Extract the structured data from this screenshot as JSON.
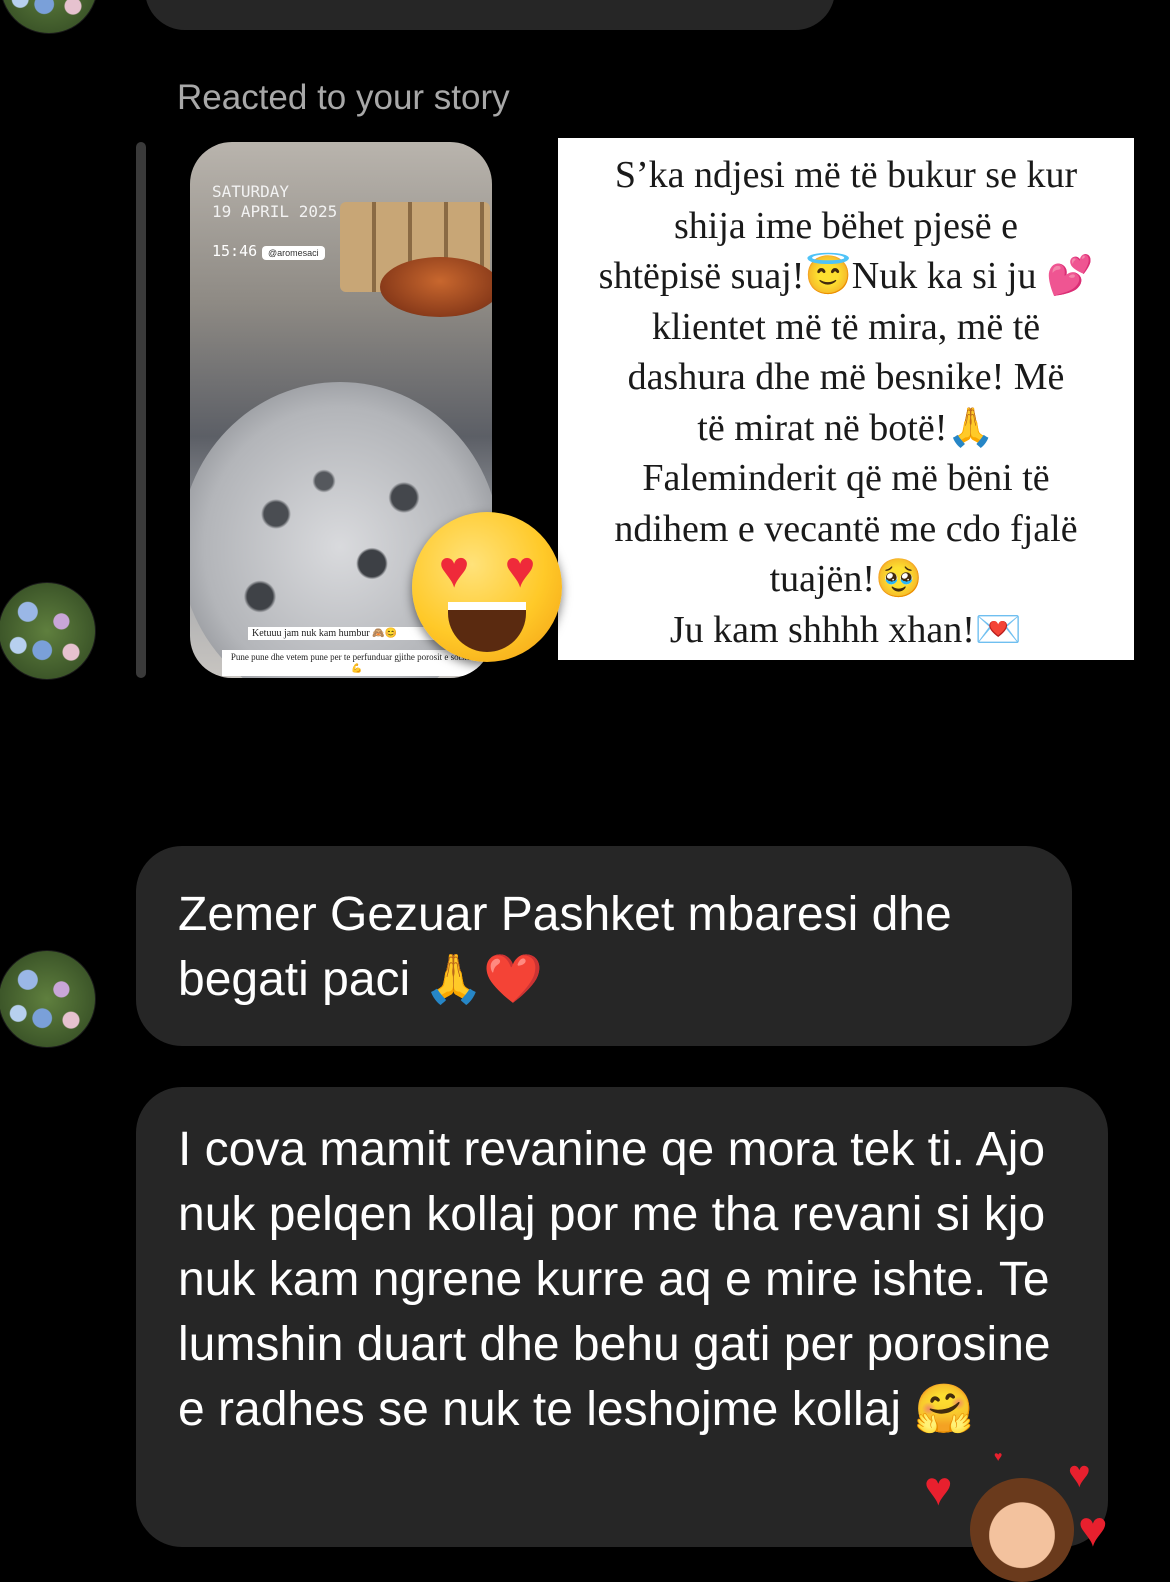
{
  "top_bubble": {
    "text": ""
  },
  "story_reply": {
    "label": "Reacted to your story",
    "thumbnail": {
      "date_line1": "SATURDAY",
      "date_line2": "19 APRIL 2025",
      "time": "15:46",
      "tag": "@aromesaci",
      "caption1": "Ketuuu jam nuk kam humbur 🙈😊",
      "caption2": "Pune pune dhe vetem pune per te perfunduar gjithe porosit e sotshme!💪"
    },
    "reaction_emoji": "heart-eyes-emoji",
    "card_lines": [
      "S’ka ndjesi më të bukur se kur",
      "shija ime bëhet pjesë e",
      "shtëpisë suaj!😇Nuk ka si ju 💕",
      "klientet më të mira, më të",
      "dashura dhe më besnike! Më",
      "të mirat në botë!🙏",
      "Faleminderit që më bëni të",
      "ndihem e vecantë me cdo fjalë",
      "tuajën!🥹",
      "Ju kam shhhh xhan!💌"
    ]
  },
  "messages": [
    {
      "text": "Zemer Gezuar Pashket mbaresi dhe begati paci 🙏❤️"
    },
    {
      "text": "I cova mamit revanine qe mora tek ti. Ajo nuk pelqen kollaj por me tha revani si kjo nuk kam ngrene kurre aq e mire ishte. Te lumshin duart dhe behu gati per porosine e radhes se nuk te leshojme kollaj 🤗"
    }
  ],
  "reaction_sticker": {
    "icon": "hearts-memoji-sticker"
  },
  "colors": {
    "background": "#000000",
    "bubble": "#262626",
    "label": "#a8a8a8"
  }
}
